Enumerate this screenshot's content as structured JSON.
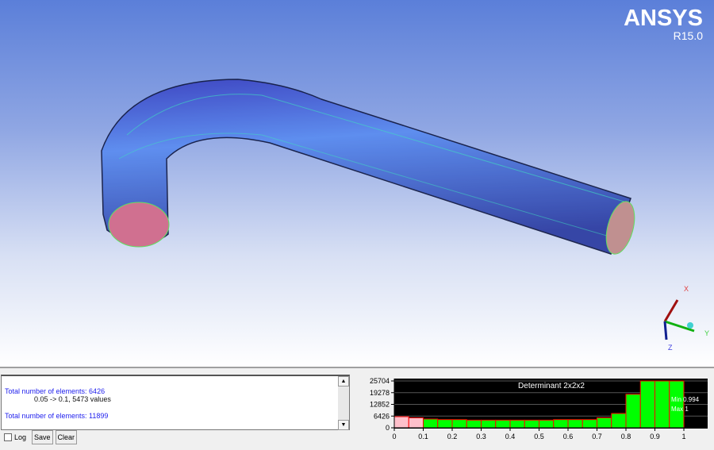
{
  "logo": {
    "brand": "ANSYS",
    "release": "R15.0"
  },
  "triad": {
    "x": "X",
    "y": "Y",
    "z": "Z"
  },
  "log": {
    "lines": [
      "Total number of elements: 6426",
      "0.05 -> 0.1, 5473 values",
      "Total number of elements: 11899"
    ]
  },
  "controls": {
    "log_label": "Log",
    "save_label": "Save",
    "clear_label": "Clear",
    "log_checked": false
  },
  "colors": {
    "good": "#00ff00",
    "bad": "#ffc0cb",
    "edge": "#ff0000",
    "bg": "#000000"
  },
  "chart_data": {
    "type": "bar",
    "title": "Determinant 2x2x2",
    "bin_edges": [
      0,
      0.05,
      0.1,
      0.15,
      0.2,
      0.25,
      0.3,
      0.35,
      0.4,
      0.45,
      0.5,
      0.55,
      0.6,
      0.65,
      0.7,
      0.75,
      0.8,
      0.85,
      0.9,
      0.95,
      1
    ],
    "values": [
      6100,
      5473,
      4800,
      4500,
      4500,
      4200,
      4200,
      4200,
      4200,
      4200,
      4200,
      4500,
      4500,
      4500,
      5500,
      7850,
      18400,
      26000,
      26000,
      26000
    ],
    "ylim": [
      0,
      25704
    ],
    "xlim": [
      0,
      1.17
    ],
    "yticks": [
      "0",
      "6426",
      "12852",
      "19278",
      "25704"
    ],
    "xticks": [
      "0",
      "0.1",
      "0.2",
      "0.3",
      "0.4",
      "0.5",
      "0.6",
      "0.7",
      "0.8",
      "0.9",
      "1"
    ],
    "min_label": "Min 0.994",
    "max_label": "Max 1",
    "bad_threshold": 0.1
  }
}
